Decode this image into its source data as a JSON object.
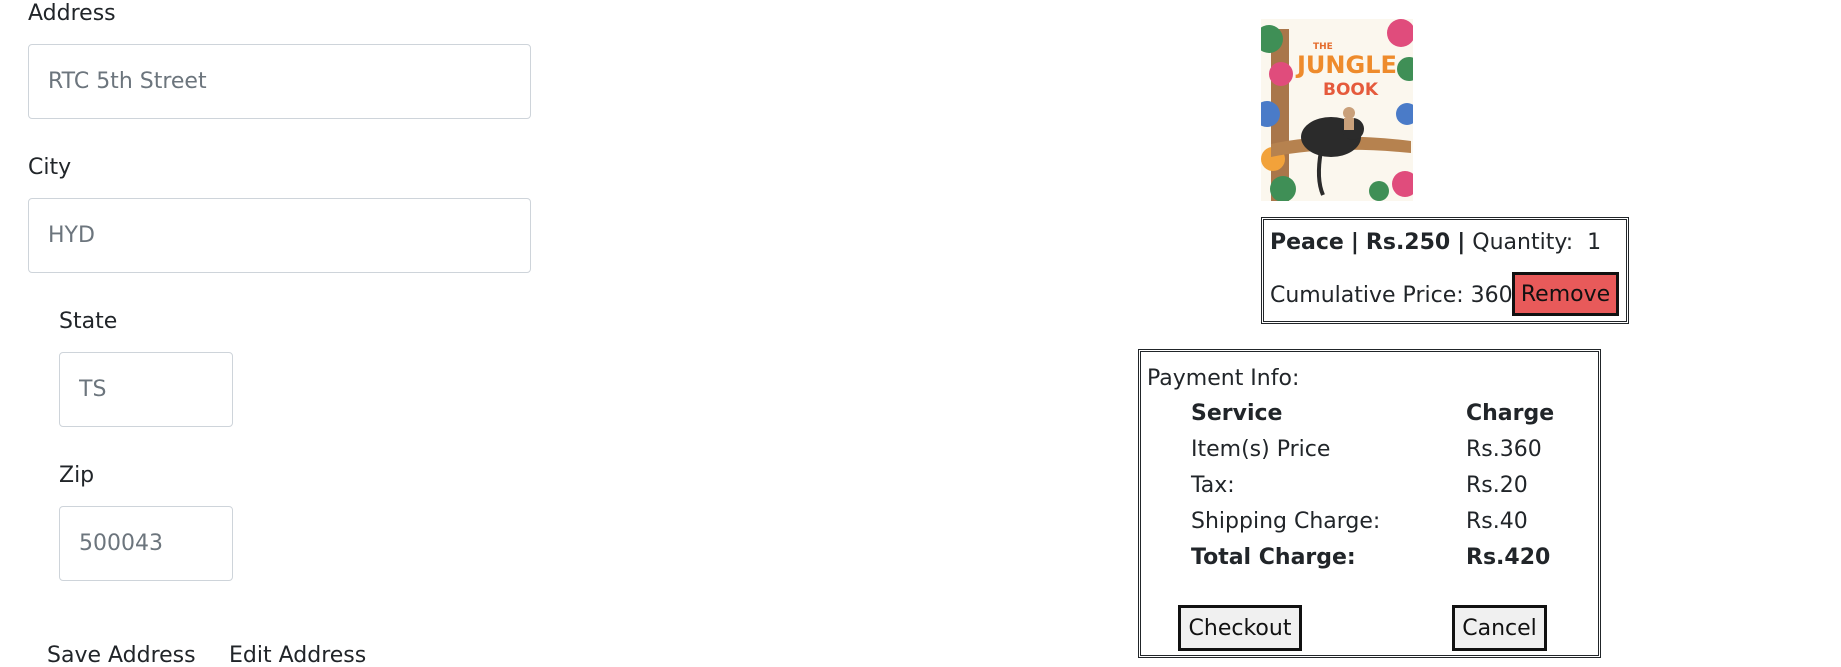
{
  "address_form": {
    "address": {
      "label": "Address",
      "placeholder": "RTC 5th Street"
    },
    "city": {
      "label": "City",
      "placeholder": "HYD"
    },
    "state": {
      "label": "State",
      "placeholder": "TS"
    },
    "zip": {
      "label": "Zip",
      "placeholder": "500043"
    },
    "save_label": "Save Address",
    "edit_label": "Edit Address"
  },
  "cart_item": {
    "cover_title_the": "THE",
    "cover_title_jungle": "JUNGLE",
    "cover_title_book": "BOOK",
    "name": "Peace",
    "separator": "|",
    "price": "Rs.250",
    "quantity_label": "Quantity:",
    "quantity": "1",
    "cumulative_label": "Cumulative Price:",
    "cumulative_value": "360",
    "remove_label": "Remove"
  },
  "payment": {
    "title": "Payment Info:",
    "header_service": "Service",
    "header_charge": "Charge",
    "rows": [
      {
        "service": "Item(s) Price",
        "charge": "Rs.360"
      },
      {
        "service": "Tax:",
        "charge": "Rs.20"
      },
      {
        "service": "Shipping Charge:",
        "charge": "Rs.40"
      }
    ],
    "total_label": "Total Charge:",
    "total_value": "Rs.420",
    "checkout_label": "Checkout",
    "cancel_label": "Cancel"
  },
  "colors": {
    "remove_button": "#e85a5a",
    "border": "#212529",
    "placeholder": "#6c757d"
  }
}
